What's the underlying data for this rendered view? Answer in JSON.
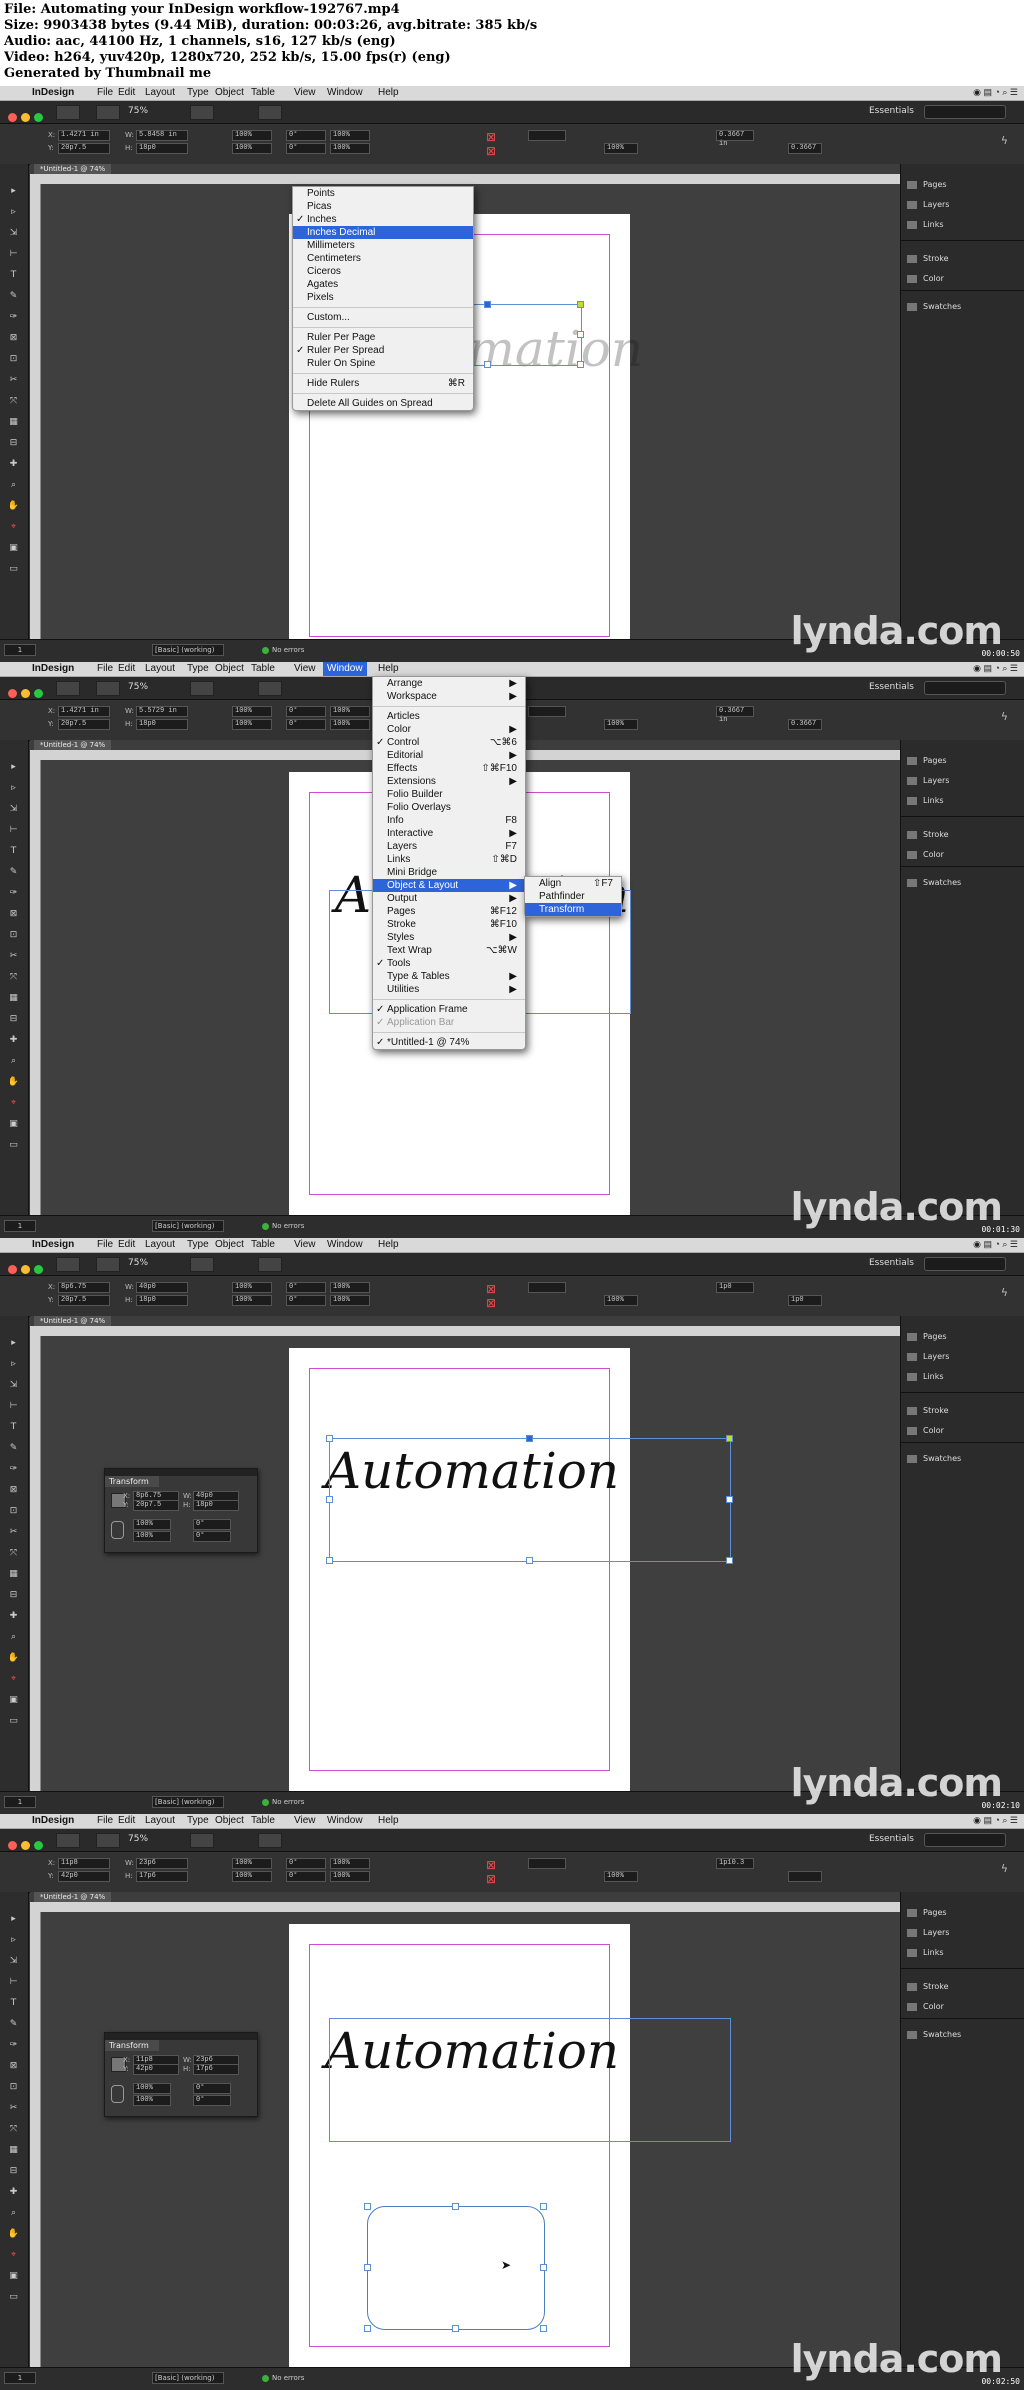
{
  "header": {
    "lines": [
      "File: Automating your InDesign workflow-192767.mp4",
      "Size: 9903438 bytes (9.44 MiB), duration: 00:03:26, avg.bitrate: 385 kb/s",
      "Audio: aac, 44100 Hz, 1 channels, s16, 127 kb/s (eng)",
      "Video: h264, yuv420p, 1280x720, 252 kb/s, 15.00 fps(r) (eng)",
      "Generated by Thumbnail me"
    ]
  },
  "menubar": {
    "app": "InDesign",
    "items": [
      "File",
      "Edit",
      "Layout",
      "Type",
      "Object",
      "Table",
      "View",
      "Window",
      "Help"
    ]
  },
  "appbar": {
    "zoom": "75%",
    "workspace": "Essentials"
  },
  "document_tab": "*Untitled-1 @ 74%",
  "panel": {
    "items": [
      "Pages",
      "Layers",
      "Links",
      "Stroke",
      "Color",
      "Swatches"
    ]
  },
  "status": {
    "page": "1",
    "style": "[Basic] (working)",
    "errors": "No errors"
  },
  "watermark": "lynda.com",
  "artwork_text": "Automation",
  "frames": [
    {
      "timestamp": "00:00:50",
      "fields": {
        "x": "1.4271 in",
        "y": "20p7.5",
        "w": "5.8458 in",
        "h": "18p0",
        "r": "0.3667 in",
        "s": "0.3667"
      }
    },
    {
      "timestamp": "00:01:30",
      "fields": {
        "x": "1.4271 in",
        "y": "20p7.5",
        "w": "5.5729 in",
        "h": "18p0",
        "r": "0.3667 in",
        "s": "0.3667"
      }
    },
    {
      "timestamp": "00:02:10",
      "fields": {
        "x": "8p6.75",
        "y": "20p7.5",
        "w": "40p0",
        "h": "18p0",
        "r": "1p0",
        "s": "1p0"
      }
    },
    {
      "timestamp": "00:02:50",
      "fields": {
        "x": "11p8",
        "y": "42p0",
        "w": "23p6",
        "h": "17p6",
        "r": "1p10.3",
        "s": ""
      }
    }
  ],
  "ruler_menu": {
    "items": [
      {
        "label": "Points"
      },
      {
        "label": "Picas"
      },
      {
        "label": "Inches",
        "checked": true
      },
      {
        "label": "Inches Decimal",
        "highlighted": true
      },
      {
        "label": "Millimeters"
      },
      {
        "label": "Centimeters"
      },
      {
        "label": "Ciceros"
      },
      {
        "label": "Agates"
      },
      {
        "label": "Pixels"
      },
      {
        "sep": true
      },
      {
        "label": "Custom..."
      },
      {
        "sep": true
      },
      {
        "label": "Ruler Per Page"
      },
      {
        "label": "Ruler Per Spread",
        "checked": true
      },
      {
        "label": "Ruler On Spine"
      },
      {
        "sep": true
      },
      {
        "label": "Hide Rulers",
        "shortcut": "⌘R"
      },
      {
        "sep": true
      },
      {
        "label": "Delete All Guides on Spread"
      }
    ]
  },
  "window_menu": {
    "items": [
      {
        "label": "Arrange",
        "sub": true
      },
      {
        "label": "Workspace",
        "sub": true
      },
      {
        "sep": true
      },
      {
        "label": "Articles"
      },
      {
        "label": "Color",
        "sub": true
      },
      {
        "label": "Control",
        "checked": true,
        "shortcut": "⌥⌘6"
      },
      {
        "label": "Editorial",
        "sub": true
      },
      {
        "label": "Effects",
        "shortcut": "⇧⌘F10"
      },
      {
        "label": "Extensions",
        "sub": true
      },
      {
        "label": "Folio Builder"
      },
      {
        "label": "Folio Overlays"
      },
      {
        "label": "Info",
        "shortcut": "F8"
      },
      {
        "label": "Interactive",
        "sub": true
      },
      {
        "label": "Layers",
        "shortcut": "F7"
      },
      {
        "label": "Links",
        "shortcut": "⇧⌘D"
      },
      {
        "label": "Mini Bridge"
      },
      {
        "label": "Object & Layout",
        "sub": true,
        "highlighted": true
      },
      {
        "label": "Output",
        "sub": true
      },
      {
        "label": "Pages",
        "shortcut": "⌘F12"
      },
      {
        "label": "Stroke",
        "shortcut": "⌘F10"
      },
      {
        "label": "Styles",
        "sub": true
      },
      {
        "label": "Text Wrap",
        "shortcut": "⌥⌘W"
      },
      {
        "label": "Tools",
        "checked": true
      },
      {
        "label": "Type & Tables",
        "sub": true
      },
      {
        "label": "Utilities",
        "sub": true
      },
      {
        "sep": true
      },
      {
        "label": "Application Frame",
        "checked": true
      },
      {
        "label": "Application Bar",
        "checked": true,
        "disabled": true
      },
      {
        "sep": true
      },
      {
        "label": "*Untitled-1 @ 74%",
        "checked": true
      }
    ]
  },
  "submenu": {
    "items": [
      {
        "label": "Align",
        "shortcut": "⇧F7"
      },
      {
        "label": "Pathfinder"
      },
      {
        "label": "Transform",
        "highlighted": true
      }
    ]
  },
  "transform_panel": {
    "title": "Transform",
    "scale": "100%",
    "angle": "0°",
    "values": [
      {
        "x": "8p6.75",
        "y": "20p7.5",
        "w": "40p0",
        "h": "18p0"
      },
      {
        "x": "11p8",
        "y": "42p0",
        "w": "23p6",
        "h": "17p6"
      }
    ]
  },
  "colors": {
    "accent": "#2e64d9",
    "margin": "#d24bd2",
    "selection": "#5b8fd6"
  }
}
